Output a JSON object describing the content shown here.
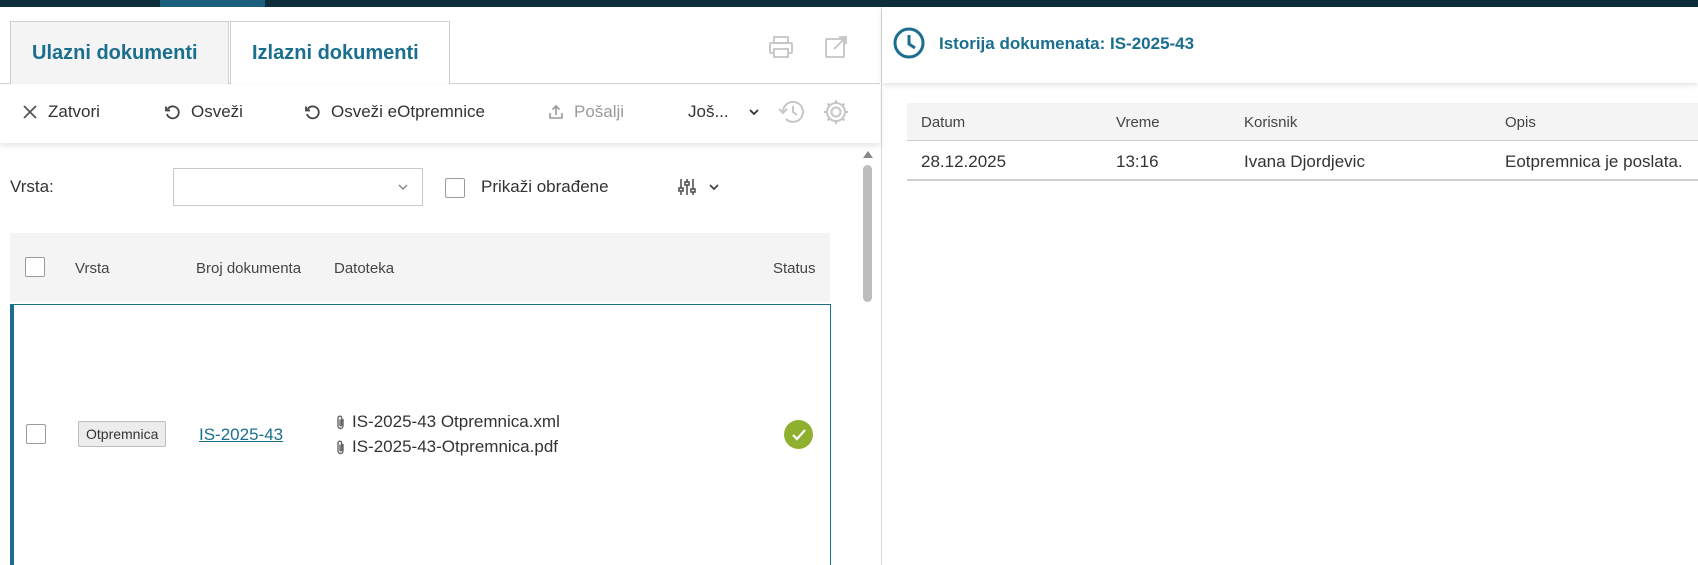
{
  "tabs": {
    "incoming": "Ulazni dokumenti",
    "outgoing": "Izlazni dokumenti"
  },
  "toolbar": {
    "close": "Zatvori",
    "refresh": "Osveži",
    "refresh_edispatch": "Osveži eOtpremnice",
    "send": "Pošalji",
    "more": "Još..."
  },
  "filter": {
    "type_label": "Vrsta:",
    "type_value": "",
    "show_processed_label": "Prikaži obrađene"
  },
  "table": {
    "headers": {
      "type": "Vrsta",
      "doc_number": "Broj dokumenta",
      "file": "Datoteka",
      "status": "Status"
    },
    "rows": [
      {
        "type": "Otpremnica",
        "doc_number": "IS-2025-43",
        "files": [
          "IS-2025-43 Otpremnica.xml",
          "IS-2025-43-Otpremnica.pdf"
        ],
        "status": "success"
      }
    ]
  },
  "history": {
    "title": "Istorija dokumenata: IS-2025-43",
    "headers": {
      "date": "Datum",
      "time": "Vreme",
      "user": "Korisnik",
      "description": "Opis"
    },
    "rows": [
      {
        "date": "28.12.2025",
        "time": "13:16",
        "user": "Ivana Djordjevic",
        "description": "Eotpremnica je poslata."
      }
    ]
  },
  "colors": {
    "accent": "#1a6e8e",
    "topbar": "#0e2d3b",
    "success": "#8fb02e"
  },
  "icons": [
    "print-icon",
    "popout-icon",
    "close-icon",
    "refresh-icon",
    "upload-icon",
    "chevron-down-icon",
    "history-icon",
    "gear-icon",
    "column-settings-icon",
    "clip-icon",
    "check-icon",
    "clock-icon"
  ]
}
